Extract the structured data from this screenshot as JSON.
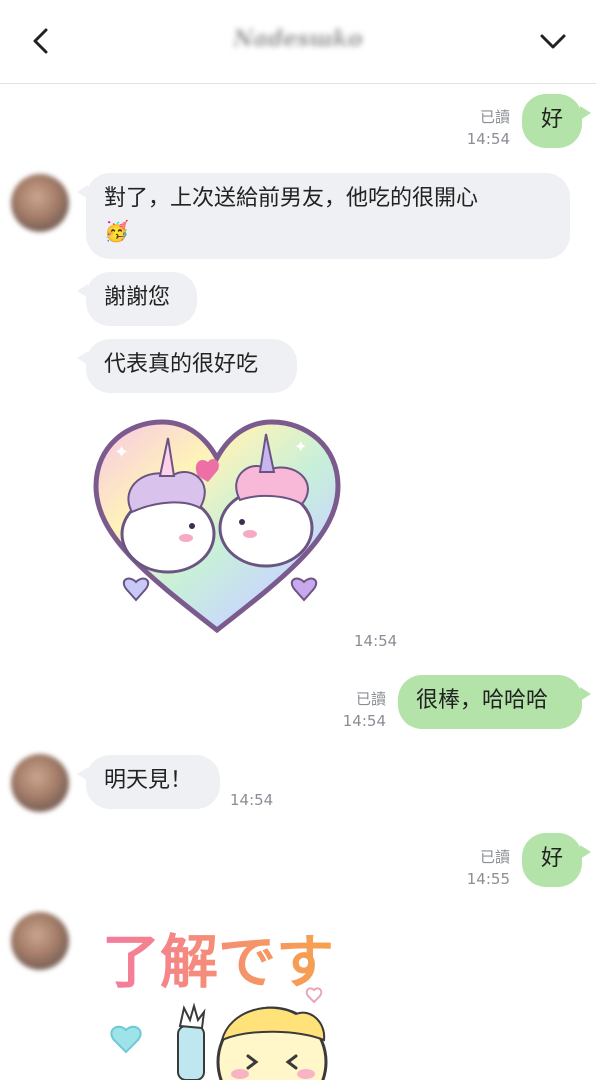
{
  "header": {
    "title": "Nadesшko",
    "back_icon": "chevron-left-icon",
    "menu_icon": "chevron-down-icon"
  },
  "colors": {
    "outgoing_bubble": "#b3e3a8",
    "incoming_bubble": "#eff0f3",
    "meta_text": "#8a8e94"
  },
  "messages": {
    "m1": {
      "text": "好",
      "read": "已讀",
      "time": "14:54"
    },
    "m2": {
      "text": "對了，上次送給前男友，他吃的很開心",
      "emoji": "🥳"
    },
    "m3": {
      "text": "謝謝您"
    },
    "m4": {
      "text": "代表真的很好吃"
    },
    "m5": {
      "sticker": "unicorn-heart-sticker",
      "time": "14:54"
    },
    "m6": {
      "text": "很棒，哈哈哈",
      "read": "已讀",
      "time": "14:54"
    },
    "m7": {
      "text": "明天見！",
      "time": "14:54"
    },
    "m8": {
      "text": "好",
      "read": "已讀",
      "time": "14:55"
    },
    "m9": {
      "sticker": "understood-sticker",
      "sticker_text": "了解です"
    }
  }
}
